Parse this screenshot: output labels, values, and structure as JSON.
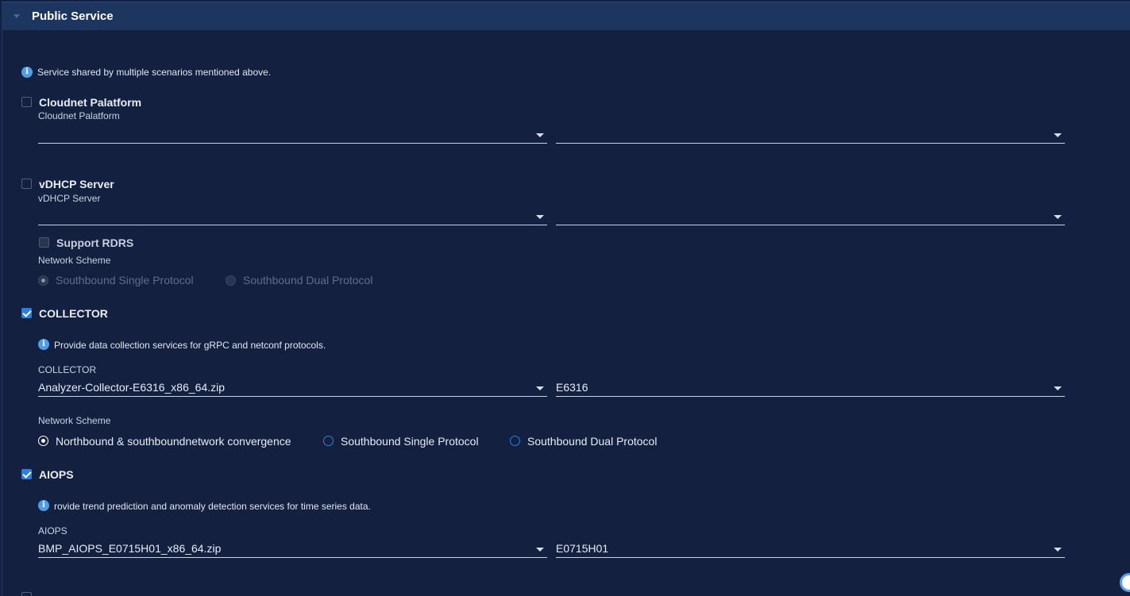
{
  "panel": {
    "title": "Public Service",
    "info": "Service shared by multiple scenarios mentioned above."
  },
  "cloudnet": {
    "title": "Cloudnet Palatform",
    "label": "Cloudnet Palatform",
    "package_value": "",
    "version_value": "",
    "checked": false
  },
  "vdhcp": {
    "title": "vDHCP Server",
    "label": "vDHCP Server",
    "package_value": "",
    "version_value": "",
    "checked": false,
    "rdrs": {
      "title": "Support RDRS",
      "checked": false,
      "scheme_label": "Network Scheme",
      "options": [
        "Southbound Single Protocol",
        "Southbound Dual Protocol"
      ],
      "selected": 0
    }
  },
  "collector": {
    "title": "COLLECTOR",
    "checked": true,
    "info": "Provide data collection services for gRPC and netconf protocols.",
    "label": "COLLECTOR",
    "package_value": "Analyzer-Collector-E6316_x86_64.zip",
    "version_value": "E6316",
    "scheme_label": "Network Scheme",
    "options": [
      "Northbound & southboundnetwork convergence",
      "Southbound Single Protocol",
      "Southbound Dual Protocol"
    ],
    "selected": 0
  },
  "aiops": {
    "title": "AIOPS",
    "checked": true,
    "info": "rovide trend prediction and anomaly detection services for time series data.",
    "label": "AIOPS",
    "package_value": "BMP_AIOPS_E0715H01_x86_64.zip",
    "version_value": "E0715H01"
  },
  "icons": {
    "info": "info-icon",
    "caret": "chevron-down-icon",
    "collapse": "collapse-arrow-icon",
    "help": "help-badge-icon"
  },
  "colors": {
    "background": "#142040",
    "header": "#1d3660",
    "accent": "#2a7fe0",
    "info": "#4d9dea"
  }
}
